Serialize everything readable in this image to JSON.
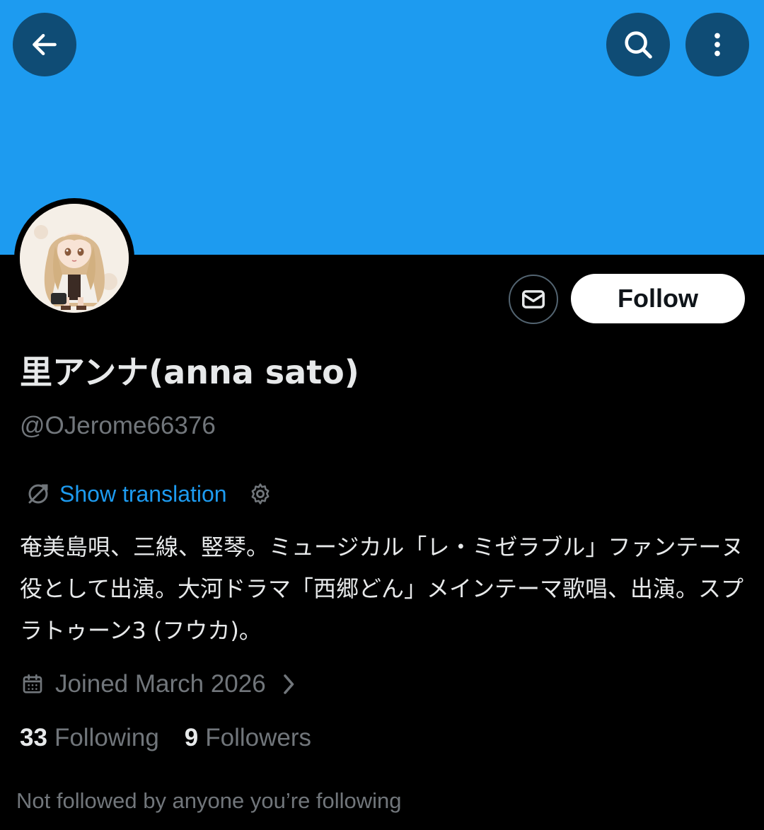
{
  "colors": {
    "banner": "#1d9bf0",
    "background": "#000000",
    "icon_button_bg": "#0f4c75",
    "accent_link": "#1d9bf0",
    "primary_text": "#e7e9ea",
    "secondary_text": "#71767b",
    "follow_button_bg": "#ffffff",
    "follow_button_text": "#0f1419"
  },
  "header": {
    "back_icon": "arrow-left-icon",
    "search_icon": "search-icon",
    "more_icon": "more-vertical-icon"
  },
  "profile": {
    "display_name": "里アンナ(anna sato)",
    "handle": "@OJerome66376",
    "avatar_icon": "anime-girl-avatar"
  },
  "actions": {
    "message_icon": "envelope-icon",
    "follow_label": "Follow"
  },
  "translation": {
    "label": "Show translation",
    "icon": "translate-icon",
    "settings_icon": "gear-icon"
  },
  "bio": "奄美島唄、三線、竪琴。ミュージカル「レ・ミゼラブル」ファンテーヌ役として出演。大河ドラマ「西郷どん」メインテーマ歌唱、出演。スプラトゥーン3 (フウカ)。",
  "joined": {
    "icon": "calendar-icon",
    "text": "Joined March 2026",
    "chevron": "chevron-right-icon"
  },
  "stats": {
    "following_count": "33",
    "following_label": "Following",
    "followers_count": "9",
    "followers_label": "Followers"
  },
  "not_followed_text": "Not followed by anyone you’re following"
}
